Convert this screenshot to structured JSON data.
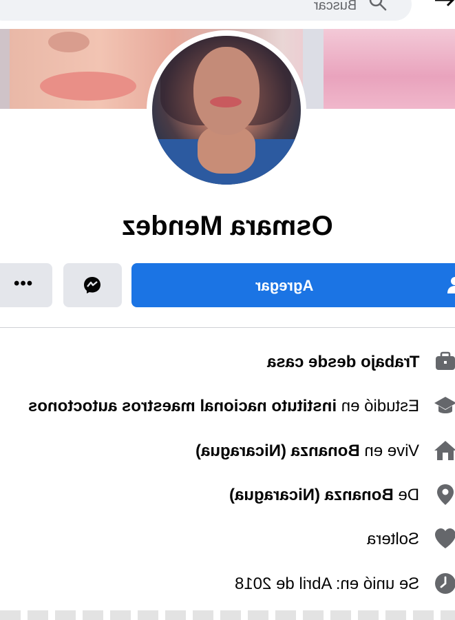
{
  "search": {
    "placeholder": "Buscar"
  },
  "profile": {
    "name": "Osmara Mendez"
  },
  "actions": {
    "add_label": "Agregar",
    "more_label": "•••"
  },
  "intro": [
    {
      "icon": "briefcase-icon",
      "prefix": "",
      "bold": "Trabajo desde casa",
      "suffix": ""
    },
    {
      "icon": "graduation-cap-icon",
      "prefix": "Estudió en ",
      "bold": "instituto nacional maestros autoctonos",
      "suffix": ""
    },
    {
      "icon": "home-icon",
      "prefix": "Vive en ",
      "bold": "Bonanza (Nicaragua)",
      "suffix": ""
    },
    {
      "icon": "location-pin-icon",
      "prefix": "De ",
      "bold": "Bonanza (Nicaragua)",
      "suffix": ""
    },
    {
      "icon": "heart-icon",
      "prefix": "Soltera",
      "bold": "",
      "suffix": ""
    },
    {
      "icon": "clock-icon",
      "prefix": "Se unió en: Abril de 2018",
      "bold": "",
      "suffix": ""
    }
  ],
  "colors": {
    "primary": "#1b74e4",
    "secondary_button": "#e4e6eb",
    "icon_gray": "#65676b"
  }
}
